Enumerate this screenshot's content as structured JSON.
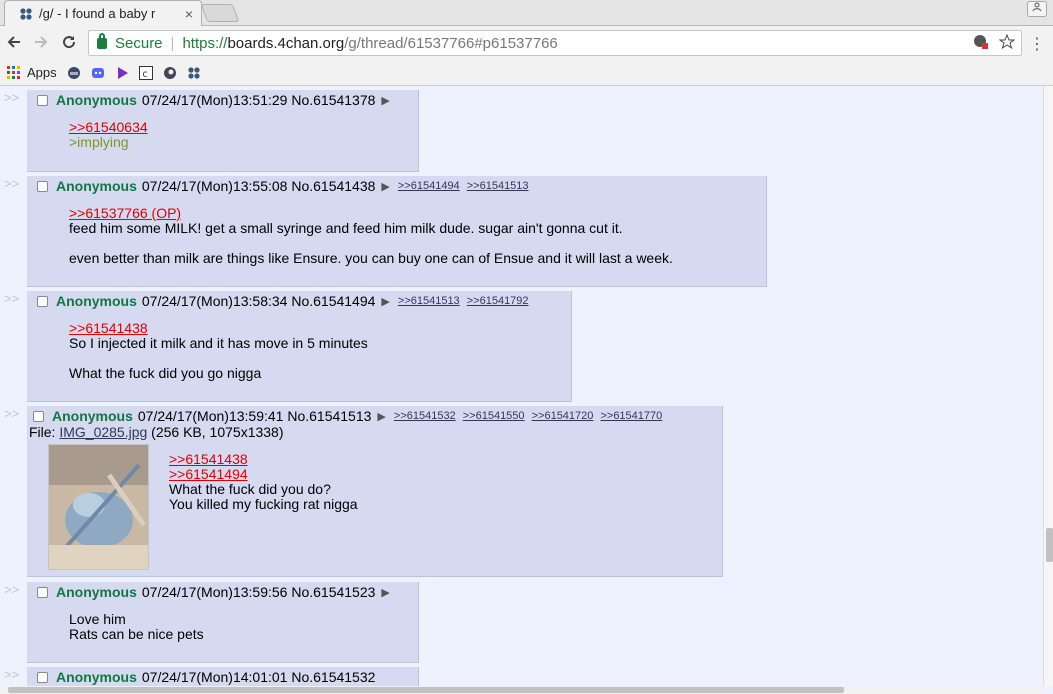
{
  "tab": {
    "title": "/g/ - I found a baby r",
    "close": "×"
  },
  "toolbar": {
    "back_icon": "back-arrow-icon",
    "forward_icon": "forward-arrow-icon",
    "reload_icon": "reload-icon",
    "secure_label": "Secure",
    "url_scheme": "https://",
    "url_host": "boards.4chan.org",
    "url_rest": "/g/thread/61537766#p61537766"
  },
  "bookmarks": {
    "apps_label": "Apps"
  },
  "posts": [
    {
      "name": "Anonymous",
      "datetime": "07/24/17(Mon)13:51:29",
      "number": "No.61541378",
      "backlinks": [],
      "quotes": [
        ">>61540634"
      ],
      "greentext": [
        ">implying"
      ],
      "lines": []
    },
    {
      "name": "Anonymous",
      "datetime": "07/24/17(Mon)13:55:08",
      "number": "No.61541438",
      "backlinks": [
        ">>61541494",
        ">>61541513"
      ],
      "quotes": [
        ">>61537766 (OP)"
      ],
      "lines": [
        "feed him some MILK! get a small syringe and feed him milk dude. sugar ain't gonna cut it.",
        "even better than milk are things like Ensure. you can buy one can of Ensue and it will last a week."
      ]
    },
    {
      "name": "Anonymous",
      "datetime": "07/24/17(Mon)13:58:34",
      "number": "No.61541494",
      "backlinks": [
        ">>61541513",
        ">>61541792"
      ],
      "quotes": [
        ">>61541438"
      ],
      "lines": [
        "So I injected it milk and it has move in 5 minutes",
        "What the fuck did you go nigga"
      ]
    },
    {
      "name": "Anonymous",
      "datetime": "07/24/17(Mon)13:59:41",
      "number": "No.61541513",
      "backlinks": [
        ">>61541532",
        ">>61541550",
        ">>61541720",
        ">>61541770"
      ],
      "file_prefix": "File: ",
      "file_name": "IMG_0285.jpg",
      "file_meta": " (256 KB, 1075x1338)",
      "quotes": [
        ">>61541438",
        ">>61541494"
      ],
      "lines": [
        "What the fuck did you do?",
        "You killed my fucking rat nigga"
      ]
    },
    {
      "name": "Anonymous",
      "datetime": "07/24/17(Mon)13:59:56",
      "number": "No.61541523",
      "backlinks": [],
      "quotes": [],
      "lines": [
        "Love him",
        "Rats can be nice pets"
      ]
    },
    {
      "name": "Anonymous",
      "datetime": "07/24/17(Mon)14:01:01",
      "number": "No.61541532",
      "backlinks": [],
      "quotes": [],
      "lines": []
    }
  ],
  "side_arrows": ">>",
  "menu_arrow": "▶"
}
